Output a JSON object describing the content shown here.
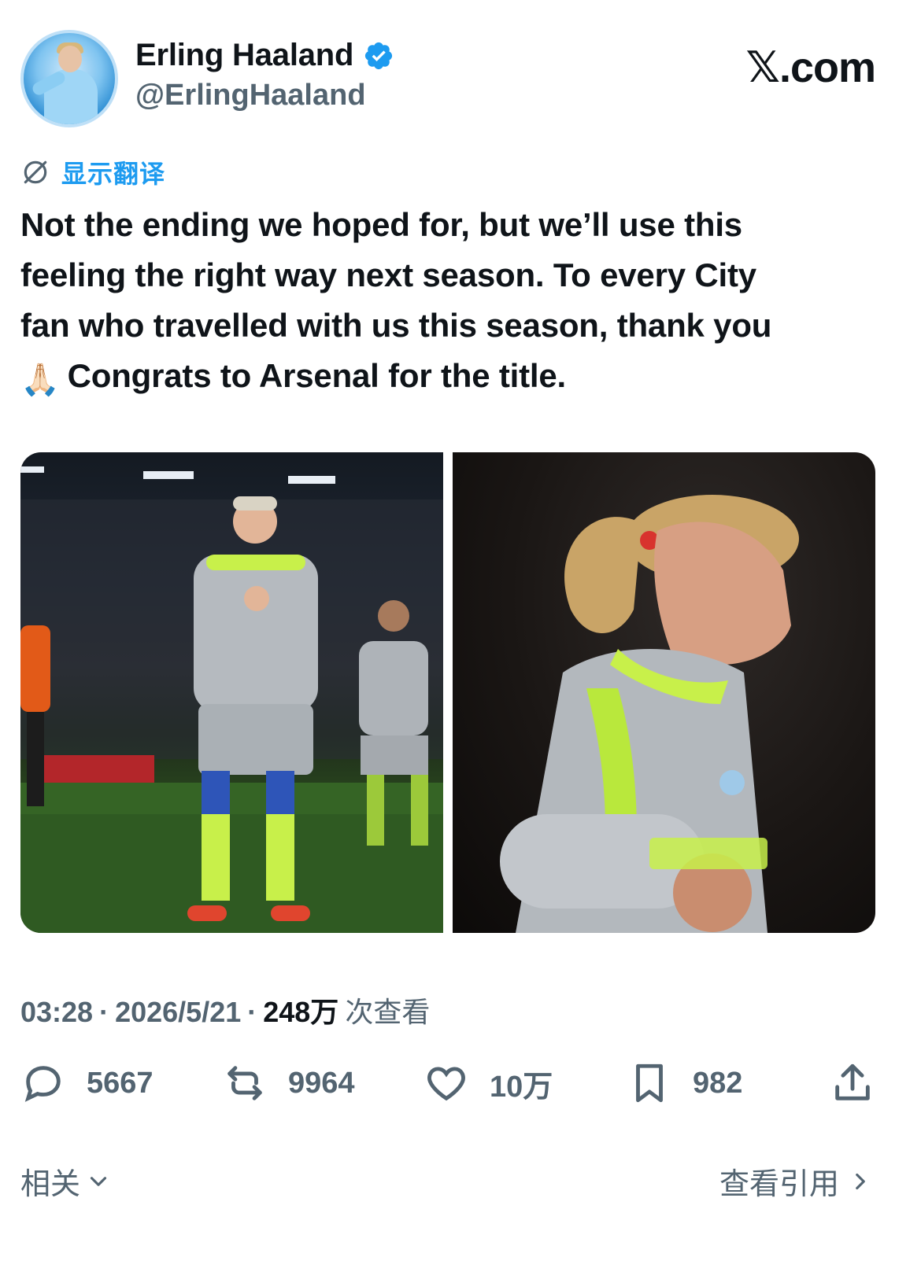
{
  "profile": {
    "name": "Erling Haaland",
    "handle": "@ErlingHaaland",
    "verified_color": "#1d9bf0"
  },
  "brand": {
    "label": "𝕏.com"
  },
  "translate": {
    "label": "显示翻译",
    "icon": "translate-off-icon"
  },
  "tweet": {
    "lines": [
      "Not the ending we hoped for, but we’ll use this",
      "feeling the right way next season. To every City",
      "fan who travelled with us this season, thank you",
      "Congrats to Arsenal for the title."
    ],
    "emoji": "🙏🏻"
  },
  "meta": {
    "time": "03:28",
    "sep1": "·",
    "date": "2026/5/21",
    "sep2": "·",
    "views": "248万",
    "views_label": "次查看"
  },
  "actions": {
    "replies": "5667",
    "reposts": "9964",
    "likes": "10万",
    "bookmarks": "982"
  },
  "footer": {
    "related_label": "相关",
    "quotes_label": "查看引用"
  },
  "colors": {
    "accent": "#1d9bf0",
    "text_primary": "#0f1419",
    "text_secondary": "#536471",
    "kit_lime": "#c8f04a"
  }
}
